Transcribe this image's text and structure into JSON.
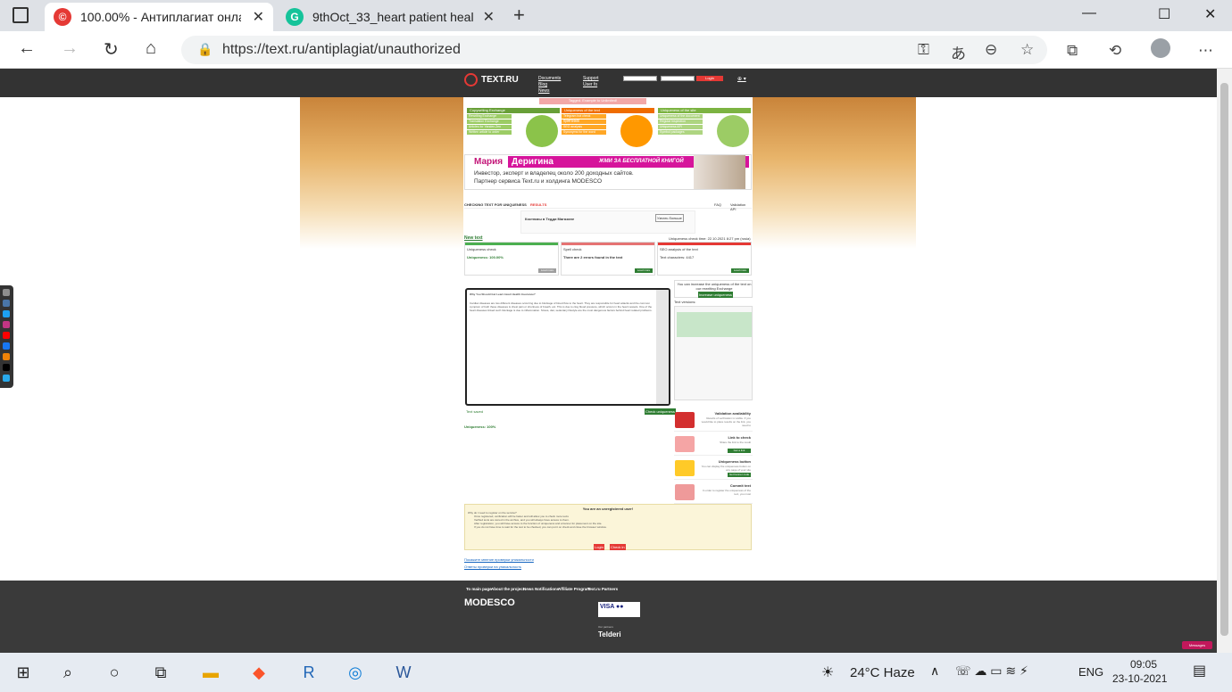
{
  "browser": {
    "tabs": [
      {
        "title": "100.00% - Антиплагиат онлайн,",
        "active": true
      },
      {
        "title": "9thOct_33_heart patient health i",
        "active": false
      }
    ],
    "url": "https://text.ru/antiplagiat/unauthorized",
    "colors": {
      "tab_bg": "#dee1e6",
      "textru_red": "#e53935",
      "grammarly_green": "#15c39a"
    }
  },
  "site": {
    "logo": "TEXT.RU",
    "top_links": [
      "Documents",
      "Blog",
      "News",
      "Support",
      "User fo"
    ],
    "login_btn": "Login",
    "pink_notice": "Tagged. Example to Unlimited!",
    "promos": [
      {
        "head": "Copywriting Exchange",
        "items": [
          "Rewriting Exchange",
          "Translation Exchange",
          "Articles for Yandex.Zen",
          "Written article to order"
        ],
        "color": "#8bc34a"
      },
      {
        "head": "Uniqueness of the text",
        "items": [
          "Telegram bot check uniqueness",
          "Spell check",
          "SEO analysis",
          "Synonyms for the word"
        ],
        "color": "#ff9800"
      },
      {
        "head": "Uniqueness of the site",
        "items": [
          "Uniqueness of the document",
          "Regular inspection",
          "Uniqueness API",
          "Symbol packages"
        ],
        "color": "#8bc34a"
      }
    ],
    "banner": {
      "name_first": "Мария",
      "name_last": "Деригина",
      "cta": "ЖМИ ЗА БЕСПЛАТНОЙ КНИГОЙ",
      "line1": "Инвестор, эксперт и владелец около 200 доходных сайтов.",
      "line2": "Партнер сервиса Text.ru и холдинга MODESCO"
    },
    "section_tabs": [
      "CHECKING TEXT FOR UNIQUENESS",
      "RESULTS"
    ],
    "right_tabs": [
      "FAQ",
      "Validation API"
    ],
    "ad": {
      "title": "Костюмы в Тедди Магазине",
      "button": "Узнать больше"
    },
    "new_text": "New text",
    "check_time": "Uniqueness check time: 22.10.2021 8:27 pm (rosia)",
    "cards": [
      {
        "title": "Uniqueness check",
        "value": "Uniqueness: 100.00%",
        "button": "Load more",
        "color": "#4caf50"
      },
      {
        "title": "Spell check",
        "value": "There are 2 errors found in the text",
        "button": "Load more",
        "color": "#e57373"
      },
      {
        "title": "SEO analysis of the text",
        "value": "Text characters: 4417",
        "button": "Load more",
        "color": "#e53935"
      }
    ],
    "editor_heading": "Why You Should Get Learn Heart Health Insurance?",
    "editor_text": "Cardiac diseases are two different diseases occurring due to blockage of blood flow to the heart. They are responsible for heart attacks and the common symptom of both these diseases is chest pain or shortness of breath, etc. This is due to clog blood pressure, which occurs in the heart vessels. One of the heart diseases linked such blockage is due to inflammation. Stress, diet, sedentary lifestyle are the most dangerous factors behind heart related problems.",
    "text_saved": "Text saved",
    "check_uniq_btn": "Check uniqueness",
    "uniqueness_result": "Uniqueness: 100%",
    "raise_uniq": "You can increase the uniqueness of the text on our rewriting Exchange",
    "raise_btn": "Increase uniqueness",
    "text_versions": "Text versions:",
    "side_items": [
      {
        "title": "Validation availability",
        "desc": "Results of verification is visible. If you would like to place results on the link, you need to",
        "thumb": "#d32f2f"
      },
      {
        "title": "Link to check",
        "desc": "Share the link to the result",
        "button": "Get a link",
        "thumb": "#f5a5a5"
      },
      {
        "title": "Uniqueness button",
        "desc": "You can display the uniqueness button on any page of your site",
        "button": "Get banner code",
        "thumb": "#ffca28"
      },
      {
        "title": "Commit text",
        "desc": "In order to register the uniqueness of the text, you must",
        "thumb": "#ef9a9a"
      }
    ],
    "unreg": {
      "title": "You are an unregistered user!",
      "subtitle": "Why do I need to register on the service?",
      "items": [
        "Once registered, verification will be faster and will allow you to check more texts",
        "Verified texts are stored in the archive, and you will always have access to them.",
        "After registration, you will have access to the function of uniqueness and a banner for placement on the site.",
        "If you do not have time to wait for the text to be checked, you can put it on check and close the browser window."
      ],
      "login_btn": "Login",
      "check_btn": "Check in"
    },
    "bottom_links": [
      "Покажите мнение проверки уникальности",
      "Ответы проверки на уникальность"
    ],
    "footer": {
      "links": [
        "To main page",
        "About the project",
        "News",
        "Notifications",
        "Affiliate Program",
        "Text.ru Partners"
      ],
      "brand": "MODESCO",
      "telderi": "Telderi",
      "our_partners": "Our partners"
    },
    "message_btn": "Messages"
  },
  "taskbar": {
    "weather": "24°C  Haze",
    "lang": "ENG",
    "time": "09:05",
    "date": "23-10-2021"
  }
}
